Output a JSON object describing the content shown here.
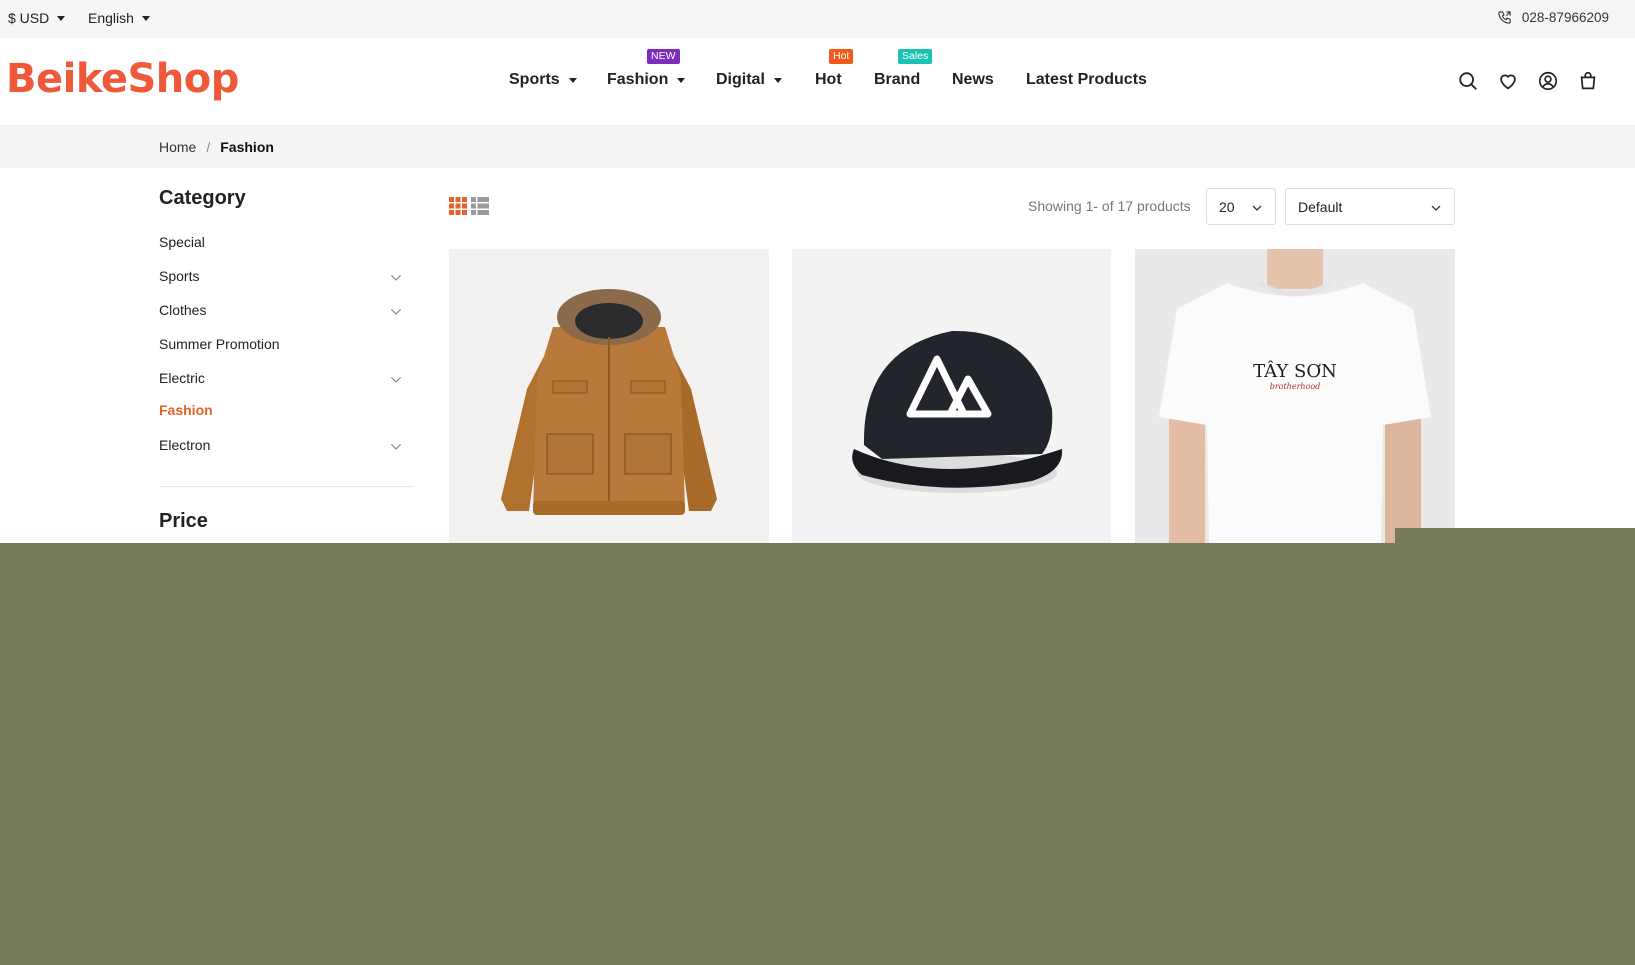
{
  "topbar": {
    "currency": "$ USD",
    "language": "English",
    "phone": "028-87966209"
  },
  "header": {
    "logo": "BeikeShop",
    "nav": [
      {
        "label": "Sports",
        "dropdown": true,
        "badge": null
      },
      {
        "label": "Fashion",
        "dropdown": true,
        "badge": "NEW"
      },
      {
        "label": "Digital",
        "dropdown": true,
        "badge": null
      },
      {
        "label": "Hot",
        "dropdown": false,
        "badge": "Hot"
      },
      {
        "label": "Brand",
        "dropdown": false,
        "badge": "Sales"
      },
      {
        "label": "News",
        "dropdown": false,
        "badge": null
      },
      {
        "label": "Latest Products",
        "dropdown": false,
        "badge": null
      }
    ],
    "icons": [
      "search-icon",
      "heart-icon",
      "account-icon",
      "cart-icon"
    ],
    "brand_color": "#f0583a"
  },
  "breadcrumb": {
    "home": "Home",
    "separator": "/",
    "current": "Fashion"
  },
  "sidebar": {
    "category_title": "Category",
    "categories": [
      {
        "label": "Special",
        "expandable": false,
        "active": false
      },
      {
        "label": "Sports",
        "expandable": true,
        "active": false
      },
      {
        "label": "Clothes",
        "expandable": true,
        "active": false
      },
      {
        "label": "Summer Promotion",
        "expandable": false,
        "active": false
      },
      {
        "label": "Electric",
        "expandable": true,
        "active": false
      },
      {
        "label": "Fashion",
        "expandable": false,
        "active": true
      },
      {
        "label": "Electron",
        "expandable": true,
        "active": false
      }
    ],
    "price_title": "Price",
    "active_color": "#e5632a"
  },
  "toolbar": {
    "showing": "Showing 1- of 17 products",
    "per_page": "20",
    "sort": "Default",
    "views": [
      "grid-view-icon",
      "list-view-icon"
    ]
  },
  "products": [
    {
      "name": "jacket-product-image"
    },
    {
      "name": "cap-product-image"
    },
    {
      "name": "tshirt-product-image",
      "print": "TÂY SƠN",
      "print_sub": "brotherhood"
    }
  ],
  "overlay_color": "#747a5a"
}
